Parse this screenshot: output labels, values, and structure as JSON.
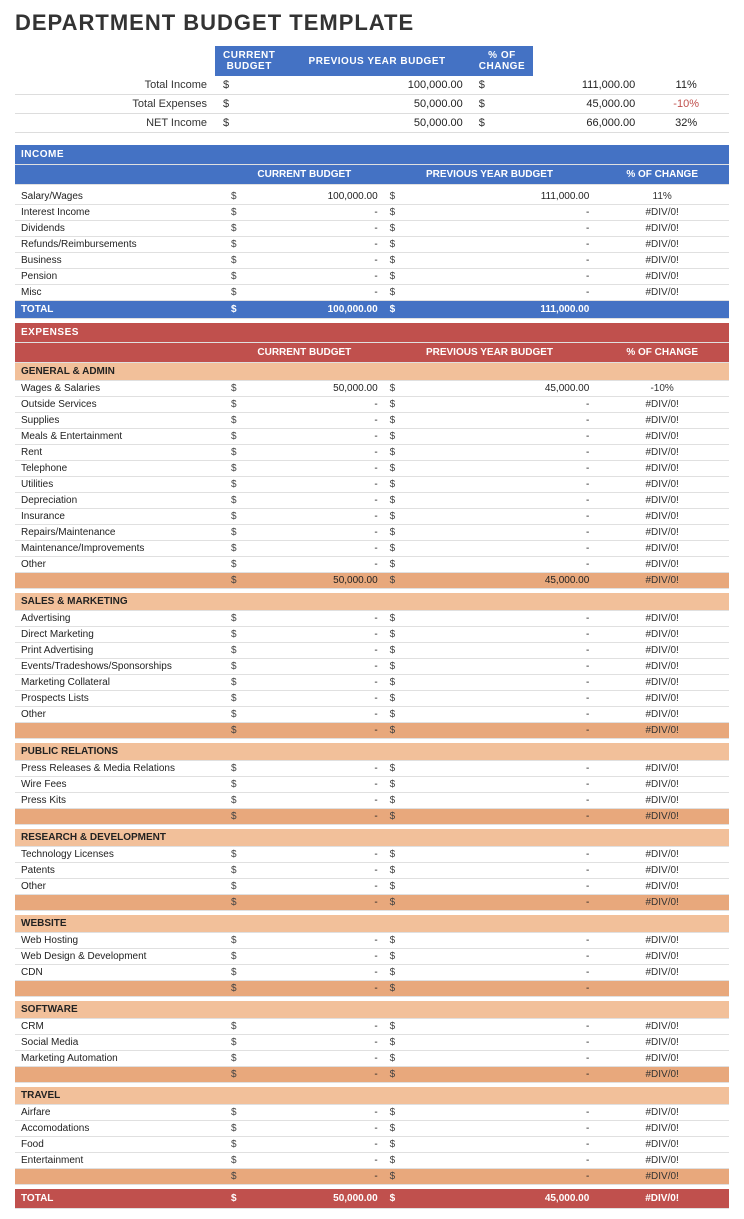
{
  "title": "DEPARTMENT BUDGET TEMPLATE",
  "summary": {
    "headers": [
      "",
      "CURRENT BUDGET",
      "PREVIOUS YEAR BUDGET",
      "% OF CHANGE"
    ],
    "rows": [
      {
        "label": "Total Income",
        "curr_dollar": "$",
        "curr": "100,000.00",
        "prev_dollar": "$",
        "prev": "111,000.00",
        "change": "11%"
      },
      {
        "label": "Total Expenses",
        "curr_dollar": "$",
        "curr": "50,000.00",
        "prev_dollar": "$",
        "prev": "45,000.00",
        "change": "-10%"
      },
      {
        "label": "NET Income",
        "curr_dollar": "$",
        "curr": "50,000.00",
        "prev_dollar": "$",
        "prev": "66,000.00",
        "change": "32%"
      }
    ]
  },
  "income": {
    "section_label": "INCOME",
    "col_headers": [
      "CURRENT BUDGET",
      "PREVIOUS YEAR BUDGET",
      "% OF CHANGE"
    ],
    "rows": [
      {
        "label": "Salary/Wages",
        "curr": "100,000.00",
        "prev": "111,000.00",
        "change": "11%"
      },
      {
        "label": "Interest Income",
        "curr": "-",
        "prev": "-",
        "change": "#DIV/0!"
      },
      {
        "label": "Dividends",
        "curr": "-",
        "prev": "-",
        "change": "#DIV/0!"
      },
      {
        "label": "Refunds/Reimbursements",
        "curr": "-",
        "prev": "-",
        "change": "#DIV/0!"
      },
      {
        "label": "Business",
        "curr": "-",
        "prev": "-",
        "change": "#DIV/0!"
      },
      {
        "label": "Pension",
        "curr": "-",
        "prev": "-",
        "change": "#DIV/0!"
      },
      {
        "label": "Misc",
        "curr": "-",
        "prev": "-",
        "change": "#DIV/0!"
      }
    ],
    "total_label": "TOTAL",
    "total_curr": "100,000.00",
    "total_prev": "111,000.00"
  },
  "expenses": {
    "section_label": "EXPENSES",
    "col_headers": [
      "CURRENT BUDGET",
      "PREVIOUS YEAR BUDGET",
      "% OF CHANGE"
    ],
    "subsections": [
      {
        "name": "GENERAL & ADMIN",
        "rows": [
          {
            "label": "Wages & Salaries",
            "curr": "50,000.00",
            "prev": "45,000.00",
            "change": "-10%"
          },
          {
            "label": "Outside Services",
            "curr": "-",
            "prev": "-",
            "change": "#DIV/0!"
          },
          {
            "label": "Supplies",
            "curr": "-",
            "prev": "-",
            "change": "#DIV/0!"
          },
          {
            "label": "Meals & Entertainment",
            "curr": "-",
            "prev": "-",
            "change": "#DIV/0!"
          },
          {
            "label": "Rent",
            "curr": "-",
            "prev": "-",
            "change": "#DIV/0!"
          },
          {
            "label": "Telephone",
            "curr": "-",
            "prev": "-",
            "change": "#DIV/0!"
          },
          {
            "label": "Utilities",
            "curr": "-",
            "prev": "-",
            "change": "#DIV/0!"
          },
          {
            "label": "Depreciation",
            "curr": "-",
            "prev": "-",
            "change": "#DIV/0!"
          },
          {
            "label": "Insurance",
            "curr": "-",
            "prev": "-",
            "change": "#DIV/0!"
          },
          {
            "label": "Repairs/Maintenance",
            "curr": "-",
            "prev": "-",
            "change": "#DIV/0!"
          },
          {
            "label": "Maintenance/Improvements",
            "curr": "-",
            "prev": "-",
            "change": "#DIV/0!"
          },
          {
            "label": "Other",
            "curr": "-",
            "prev": "-",
            "change": "#DIV/0!"
          }
        ],
        "total_curr": "50,000.00",
        "total_prev": "45,000.00",
        "total_change": "#DIV/0!"
      },
      {
        "name": "SALES & MARKETING",
        "rows": [
          {
            "label": "Advertising",
            "curr": "-",
            "prev": "-",
            "change": "#DIV/0!"
          },
          {
            "label": "Direct Marketing",
            "curr": "-",
            "prev": "-",
            "change": "#DIV/0!"
          },
          {
            "label": "Print Advertising",
            "curr": "-",
            "prev": "-",
            "change": "#DIV/0!"
          },
          {
            "label": "Events/Tradeshows/Sponsorships",
            "curr": "-",
            "prev": "-",
            "change": "#DIV/0!"
          },
          {
            "label": "Marketing Collateral",
            "curr": "-",
            "prev": "-",
            "change": "#DIV/0!"
          },
          {
            "label": "Prospects Lists",
            "curr": "-",
            "prev": "-",
            "change": "#DIV/0!"
          },
          {
            "label": "Other",
            "curr": "-",
            "prev": "-",
            "change": "#DIV/0!"
          }
        ],
        "total_curr": "-",
        "total_prev": "-",
        "total_change": "#DIV/0!"
      },
      {
        "name": "PUBLIC RELATIONS",
        "rows": [
          {
            "label": "Press Releases & Media Relations",
            "curr": "-",
            "prev": "-",
            "change": "#DIV/0!"
          },
          {
            "label": "Wire Fees",
            "curr": "-",
            "prev": "-",
            "change": "#DIV/0!"
          },
          {
            "label": "Press Kits",
            "curr": "-",
            "prev": "-",
            "change": "#DIV/0!"
          }
        ],
        "total_curr": "-",
        "total_prev": "-",
        "total_change": "#DIV/0!"
      },
      {
        "name": "RESEARCH & DEVELOPMENT",
        "rows": [
          {
            "label": "Technology Licenses",
            "curr": "-",
            "prev": "-",
            "change": "#DIV/0!"
          },
          {
            "label": "Patents",
            "curr": "-",
            "prev": "-",
            "change": "#DIV/0!"
          },
          {
            "label": "Other",
            "curr": "-",
            "prev": "-",
            "change": "#DIV/0!"
          }
        ],
        "total_curr": "-",
        "total_prev": "-",
        "total_change": "#DIV/0!"
      },
      {
        "name": "WEBSITE",
        "rows": [
          {
            "label": "Web Hosting",
            "curr": "-",
            "prev": "-",
            "change": "#DIV/0!"
          },
          {
            "label": "Web Design & Development",
            "curr": "-",
            "prev": "-",
            "change": "#DIV/0!"
          },
          {
            "label": "CDN",
            "curr": "-",
            "prev": "-",
            "change": "#DIV/0!"
          }
        ],
        "total_curr": "-",
        "total_prev": "-",
        "total_change": ""
      },
      {
        "name": "SOFTWARE",
        "rows": [
          {
            "label": "CRM",
            "curr": "-",
            "prev": "-",
            "change": "#DIV/0!"
          },
          {
            "label": "Social Media",
            "curr": "-",
            "prev": "-",
            "change": "#DIV/0!"
          },
          {
            "label": "Marketing Automation",
            "curr": "-",
            "prev": "-",
            "change": "#DIV/0!"
          }
        ],
        "total_curr": "-",
        "total_prev": "-",
        "total_change": "#DIV/0!"
      },
      {
        "name": "TRAVEL",
        "rows": [
          {
            "label": "Airfare",
            "curr": "-",
            "prev": "-",
            "change": "#DIV/0!"
          },
          {
            "label": "Accomodations",
            "curr": "-",
            "prev": "-",
            "change": "#DIV/0!"
          },
          {
            "label": "Food",
            "curr": "-",
            "prev": "-",
            "change": "#DIV/0!"
          },
          {
            "label": "Entertainment",
            "curr": "-",
            "prev": "-",
            "change": "#DIV/0!"
          }
        ],
        "total_curr": "-",
        "total_prev": "-",
        "total_change": "#DIV/0!"
      }
    ],
    "grand_total_label": "TOTAL",
    "grand_total_curr": "50,000.00",
    "grand_total_prev": "45,000.00",
    "grand_total_change": "#DIV/0!"
  }
}
